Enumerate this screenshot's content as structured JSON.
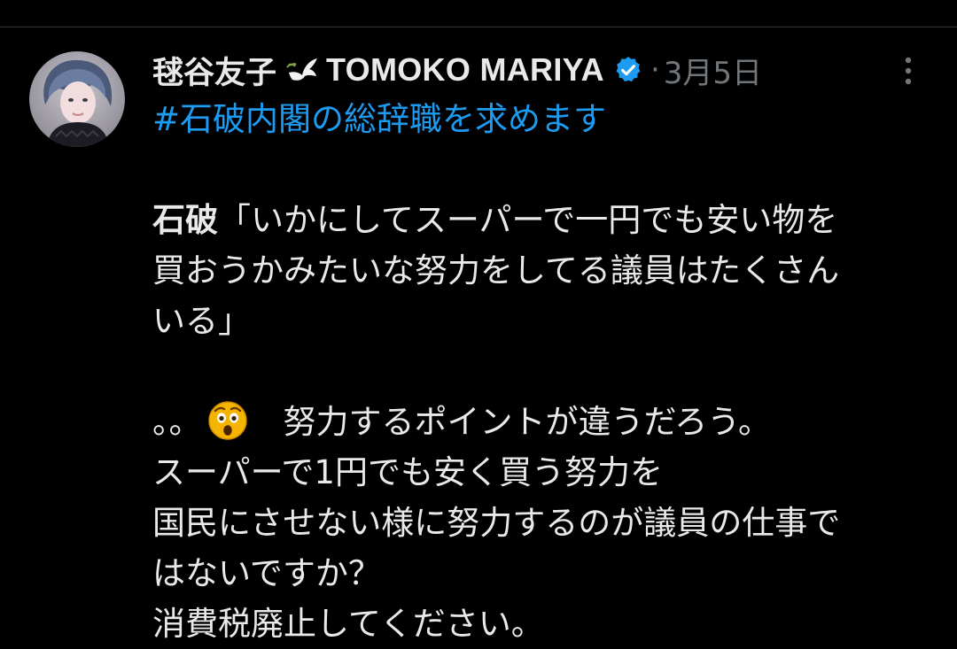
{
  "post": {
    "author": {
      "display_name": "毬谷友子",
      "name_latin": "TOMOKO MARIYA",
      "avatar_icon": "profile-photo",
      "badge_icons": [
        "dove-icon",
        "verified-icon"
      ],
      "verified_color": "#1d9bf0"
    },
    "separator": "·",
    "date": "3月5日",
    "more_icon": "more-vertical-icon",
    "hashtag": "#石破内閣の総辞職を求めます",
    "quote": {
      "speaker": "石破",
      "line1": "「いかにしてスーパーで一円でも安い物を",
      "line2": "買おうかみたいな努力をしてる議員はたくさん",
      "line3": "いる」"
    },
    "comment": {
      "prefix": "。。",
      "emoji_icon": "astonished-face-emoji",
      "line1_text": "努力するポイントが違うだろう。",
      "line2": "スーパーで1円でも安く買う努力を",
      "line3": "国民にさせない様に努力するのが議員の仕事で",
      "line4": "はないですか？",
      "line5": "消費税廃止してください。"
    }
  },
  "colors": {
    "background": "#000000",
    "text": "#e7e9ea",
    "muted": "#71767b",
    "link": "#1d9bf0"
  }
}
